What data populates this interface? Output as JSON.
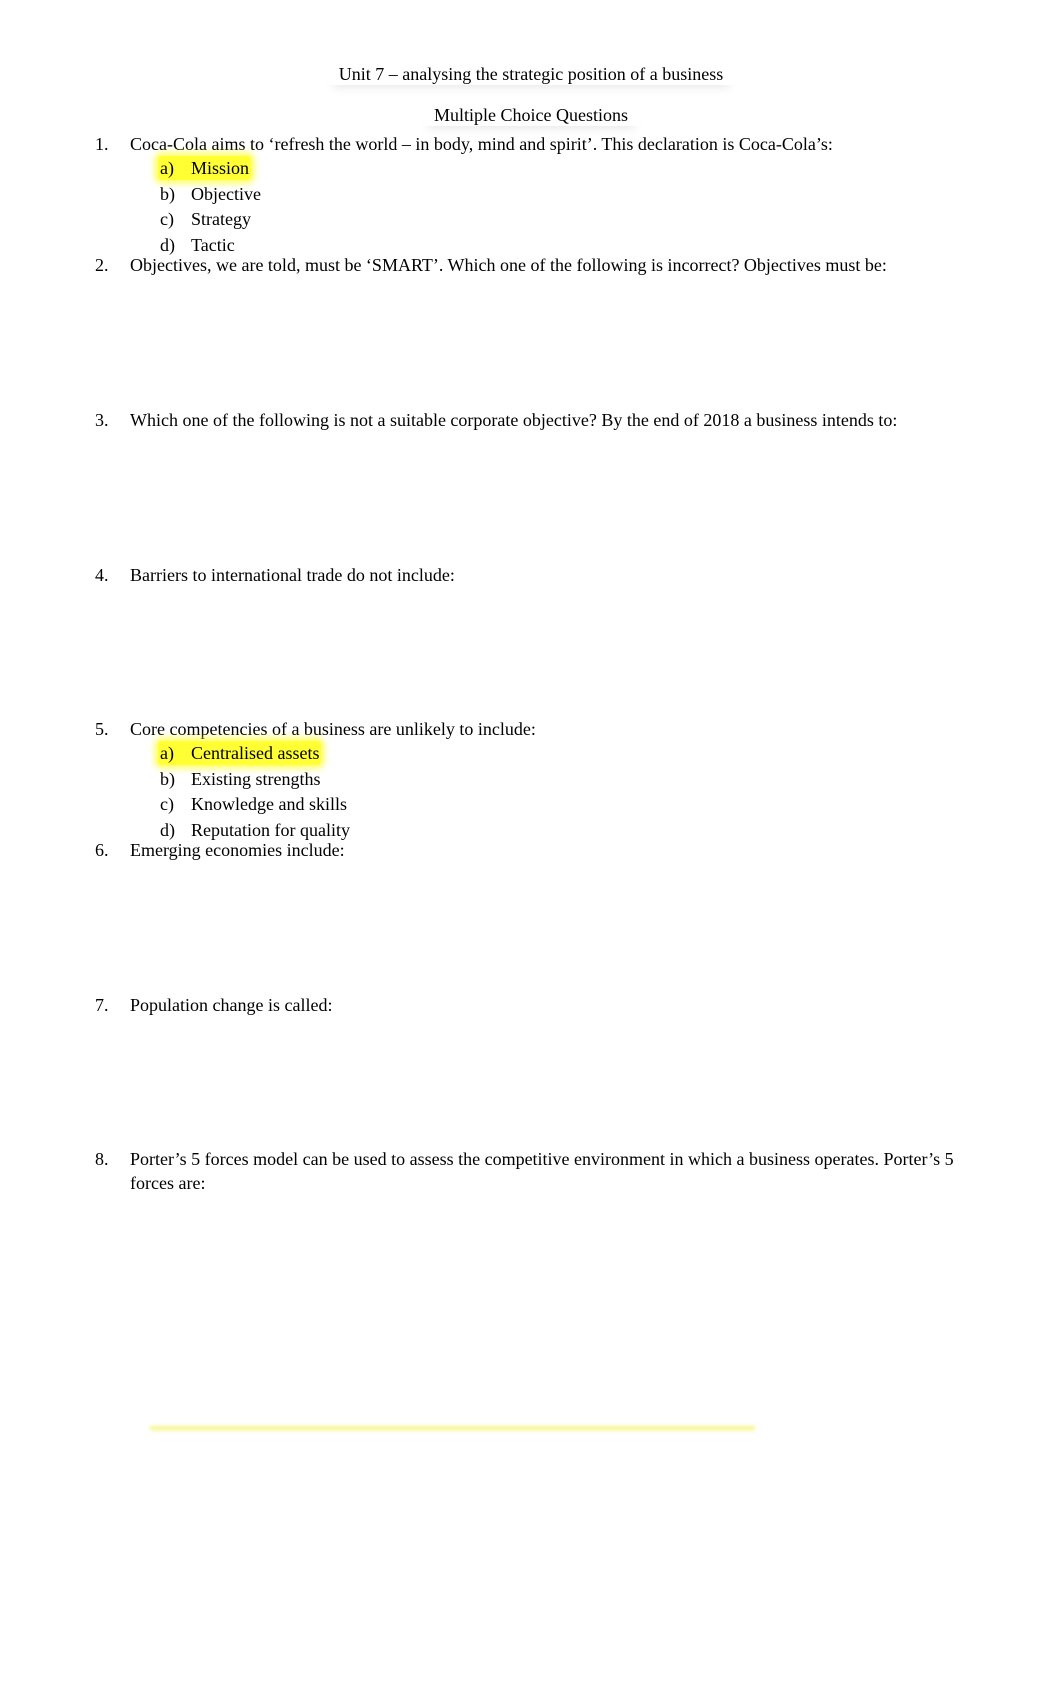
{
  "document": {
    "title": "Unit 7 – analysing the strategic position of a business",
    "subtitle": "Multiple Choice Questions",
    "highlight_color": "#ffff33",
    "questions": [
      {
        "number": "1.",
        "text": "Coca-Cola aims to ‘refresh the world – in body, mind and spirit’. This declaration is Coca-Cola’s:",
        "options": [
          {
            "letter": "a)",
            "text": "Mission",
            "highlighted": true
          },
          {
            "letter": "b)",
            "text": "Objective",
            "highlighted": false
          },
          {
            "letter": "c)",
            "text": "Strategy",
            "highlighted": false
          },
          {
            "letter": "d)",
            "text": "Tactic",
            "highlighted": false
          }
        ]
      },
      {
        "number": "2.",
        "text": "Objectives, we are told, must be ‘SMART’. Which one of the following is incorrect? Objectives must be:"
      },
      {
        "number": "3.",
        "text": "Which one of the following is not a suitable corporate objective? By the end of 2018 a business intends to:"
      },
      {
        "number": "4.",
        "text": "Barriers to international trade do not include:"
      },
      {
        "number": "5.",
        "text": "Core competencies of a business are unlikely to include:",
        "options": [
          {
            "letter": "a)",
            "text": "Centralised assets",
            "highlighted": true
          },
          {
            "letter": "b)",
            "text": "Existing strengths",
            "highlighted": false
          },
          {
            "letter": "c)",
            "text": "Knowledge and skills",
            "highlighted": false
          },
          {
            "letter": "d)",
            "text": "Reputation for quality",
            "highlighted": false
          }
        ]
      },
      {
        "number": "6.",
        "text": "Emerging economies include:"
      },
      {
        "number": "7.",
        "text": "Population change is called:"
      },
      {
        "number": "8.",
        "text": "Porter’s 5 forces model can be used to assess the competitive environment in which a business operates. Porter’s 5 forces are:"
      }
    ]
  }
}
